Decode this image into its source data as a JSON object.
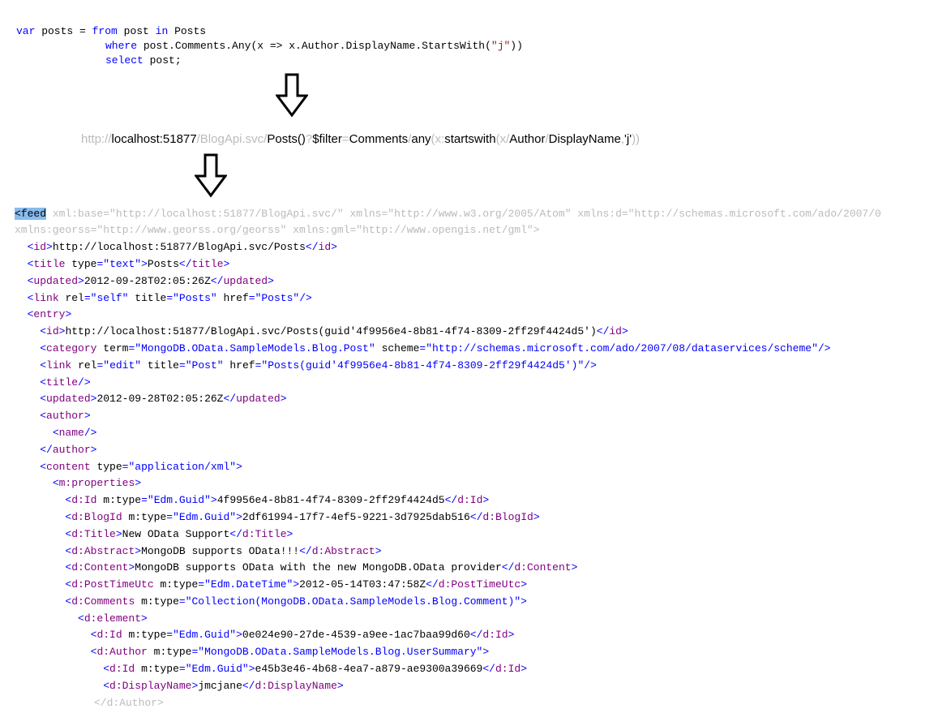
{
  "linq": {
    "l1_var": "var",
    "l1_rest1": " posts = ",
    "l1_from": "from",
    "l1_rest2": " post ",
    "l1_in": "in",
    "l1_rest3": " Posts",
    "l2_where": "where",
    "l2_rest1": " post.Comments.Any(x => x.Author.DisplayName.StartsWith(",
    "l2_str": "\"j\"",
    "l2_rest2": "))",
    "l3_select": "select",
    "l3_rest": " post;"
  },
  "url": {
    "p1": "http://",
    "p2": "localhost:51877",
    "p3": "/BlogApi.svc/",
    "p4": "Posts()",
    "p5": "?",
    "p6": "$filter",
    "p7": "=",
    "p8": "Comments",
    "p9": "/",
    "p10": "any",
    "p11": "(x:",
    "p12": "startswith",
    "p13": "(x/",
    "p14": "Author",
    "p15": "/",
    "p16": "DisplayName",
    "p17": ",",
    "p18": "'j'",
    "p19": "))"
  },
  "xml": {
    "rootA": "<feed",
    "rootB": " xml:base=\"http://localhost:51877/BlogApi.svc/\" xmlns=\"http://www.w3.org/2005/Atom\" xmlns:d=\"http://schemas.microsoft.com/ado/2007/0",
    "rootC": "xmlns:georss=\"http://www.georss.org/georss\" xmlns:gml=\"http://www.opengis.net/gml\">",
    "id_open": "id",
    "id_text": "http://localhost:51877/BlogApi.svc/Posts",
    "title_open": "title",
    "title_attr": "type",
    "title_attr_v": "\"text\"",
    "title_text": "Posts",
    "updated_open": "updated",
    "updated_text": "2012-09-28T02:05:26Z",
    "link1_open": "link",
    "link1_rel": "rel",
    "link1_rel_v": "\"self\"",
    "link1_title": "title",
    "link1_title_v": "\"Posts\"",
    "link1_href": "href",
    "link1_href_v": "\"Posts\"",
    "entry": "entry",
    "e_id_text": "http://localhost:51877/BlogApi.svc/Posts(guid'4f9956e4-8b81-4f74-8309-2ff29f4424d5')",
    "cat_open": "category",
    "cat_term": "term",
    "cat_term_v": "\"MongoDB.OData.SampleModels.Blog.Post\"",
    "cat_scheme": "scheme",
    "cat_scheme_v": "\"http://schemas.microsoft.com/ado/2007/08/dataservices/scheme\"",
    "link2_rel_v": "\"edit\"",
    "link2_title_v": "\"Post\"",
    "link2_href_v": "\"Posts(guid'4f9956e4-8b81-4f74-8309-2ff29f4424d5')\"",
    "author": "author",
    "name": "name",
    "content": "content",
    "content_type": "type",
    "content_type_v": "\"application/xml\"",
    "mprops": "m:properties",
    "dId": "d:Id",
    "mtype": "m:type",
    "guid_v": "\"Edm.Guid\"",
    "dId_text": "4f9956e4-8b81-4f74-8309-2ff29f4424d5",
    "dBlogId": "d:BlogId",
    "dBlogId_text": "2df61994-17f7-4ef5-9221-3d7925dab516",
    "dTitle": "d:Title",
    "dTitle_text": "New OData Support",
    "dAbstract": "d:Abstract",
    "dAbstract_text": "MongoDB supports OData!!!",
    "dContent": "d:Content",
    "dContent_text": "MongoDB supports OData with the new MongoDB.OData provider",
    "dPostTime": "d:PostTimeUtc",
    "datetime_v": "\"Edm.DateTime\"",
    "dPostTime_text": "2012-05-14T03:47:58Z",
    "dComments": "d:Comments",
    "coll_v": "\"Collection(MongoDB.OData.SampleModels.Blog.Comment)\"",
    "delement": "d:element",
    "cId_text": "0e024e90-27de-4539-a9ee-1ac7baa99d60",
    "dAuthor": "d:Author",
    "usum_v": "\"MongoDB.OData.SampleModels.Blog.UserSummary\"",
    "aId_text": "e45b3e46-4b68-4ea7-a879-ae9300a39669",
    "dDisplayName": "d:DisplayName",
    "dDisplayName_text": "jmcjane",
    "dAuthorClose": "</d:Author>"
  }
}
